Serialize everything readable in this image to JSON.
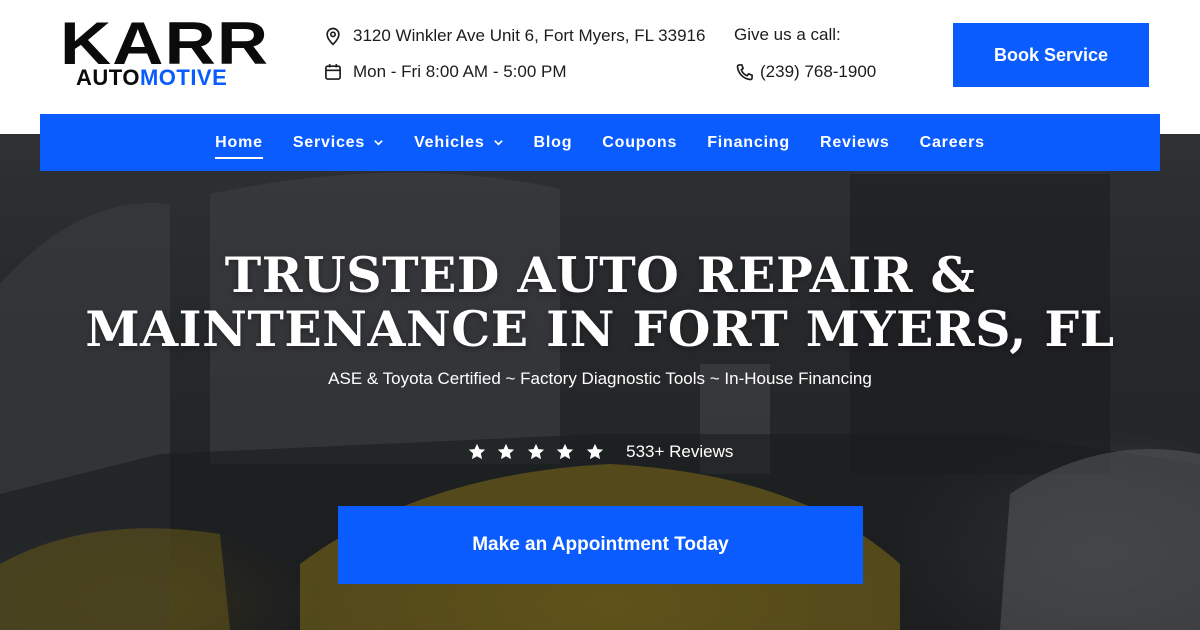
{
  "brand": {
    "logo_top": "KARR",
    "logo_auto": "AUTO",
    "logo_motive": "MOTIVE"
  },
  "header": {
    "address": "3120 Winkler Ave Unit 6, Fort Myers, FL 33916",
    "hours": "Mon - Fri 8:00 AM - 5:00 PM",
    "call_label": "Give us a call:",
    "phone": "(239) 768-1900",
    "book_button": "Book Service"
  },
  "nav": {
    "items": [
      {
        "label": "Home",
        "active": true,
        "dropdown": false
      },
      {
        "label": "Services",
        "active": false,
        "dropdown": true
      },
      {
        "label": "Vehicles",
        "active": false,
        "dropdown": true
      },
      {
        "label": "Blog",
        "active": false,
        "dropdown": false
      },
      {
        "label": "Coupons",
        "active": false,
        "dropdown": false
      },
      {
        "label": "Financing",
        "active": false,
        "dropdown": false
      },
      {
        "label": "Reviews",
        "active": false,
        "dropdown": false
      },
      {
        "label": "Careers",
        "active": false,
        "dropdown": false
      }
    ]
  },
  "hero": {
    "title_line1": "TRUSTED AUTO REPAIR &",
    "title_line2": "MAINTENANCE IN FORT MYERS, FL",
    "subtitle": "ASE & Toyota Certified ~ Factory Diagnostic Tools ~ In-House Financing",
    "stars": 5,
    "reviews": "533+ Reviews",
    "cta": "Make an Appointment Today"
  },
  "colors": {
    "accent": "#0a5cff",
    "dark": "#0b0b0b"
  },
  "icons": [
    "map-pin-icon",
    "calendar-icon",
    "phone-icon",
    "chevron-down-icon",
    "star-icon"
  ]
}
